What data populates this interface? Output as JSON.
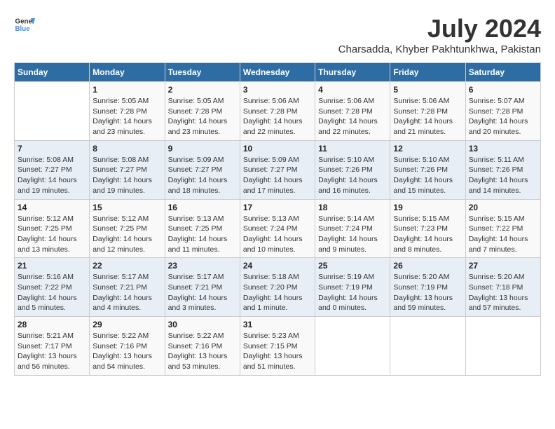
{
  "header": {
    "logo_line1": "General",
    "logo_line2": "Blue",
    "month_year": "July 2024",
    "location": "Charsadda, Khyber Pakhtunkhwa, Pakistan"
  },
  "weekdays": [
    "Sunday",
    "Monday",
    "Tuesday",
    "Wednesday",
    "Thursday",
    "Friday",
    "Saturday"
  ],
  "weeks": [
    [
      {
        "day": "",
        "info": ""
      },
      {
        "day": "1",
        "info": "Sunrise: 5:05 AM\nSunset: 7:28 PM\nDaylight: 14 hours\nand 23 minutes."
      },
      {
        "day": "2",
        "info": "Sunrise: 5:05 AM\nSunset: 7:28 PM\nDaylight: 14 hours\nand 23 minutes."
      },
      {
        "day": "3",
        "info": "Sunrise: 5:06 AM\nSunset: 7:28 PM\nDaylight: 14 hours\nand 22 minutes."
      },
      {
        "day": "4",
        "info": "Sunrise: 5:06 AM\nSunset: 7:28 PM\nDaylight: 14 hours\nand 22 minutes."
      },
      {
        "day": "5",
        "info": "Sunrise: 5:06 AM\nSunset: 7:28 PM\nDaylight: 14 hours\nand 21 minutes."
      },
      {
        "day": "6",
        "info": "Sunrise: 5:07 AM\nSunset: 7:28 PM\nDaylight: 14 hours\nand 20 minutes."
      }
    ],
    [
      {
        "day": "7",
        "info": "Sunrise: 5:08 AM\nSunset: 7:27 PM\nDaylight: 14 hours\nand 19 minutes."
      },
      {
        "day": "8",
        "info": "Sunrise: 5:08 AM\nSunset: 7:27 PM\nDaylight: 14 hours\nand 19 minutes."
      },
      {
        "day": "9",
        "info": "Sunrise: 5:09 AM\nSunset: 7:27 PM\nDaylight: 14 hours\nand 18 minutes."
      },
      {
        "day": "10",
        "info": "Sunrise: 5:09 AM\nSunset: 7:27 PM\nDaylight: 14 hours\nand 17 minutes."
      },
      {
        "day": "11",
        "info": "Sunrise: 5:10 AM\nSunset: 7:26 PM\nDaylight: 14 hours\nand 16 minutes."
      },
      {
        "day": "12",
        "info": "Sunrise: 5:10 AM\nSunset: 7:26 PM\nDaylight: 14 hours\nand 15 minutes."
      },
      {
        "day": "13",
        "info": "Sunrise: 5:11 AM\nSunset: 7:26 PM\nDaylight: 14 hours\nand 14 minutes."
      }
    ],
    [
      {
        "day": "14",
        "info": "Sunrise: 5:12 AM\nSunset: 7:25 PM\nDaylight: 14 hours\nand 13 minutes."
      },
      {
        "day": "15",
        "info": "Sunrise: 5:12 AM\nSunset: 7:25 PM\nDaylight: 14 hours\nand 12 minutes."
      },
      {
        "day": "16",
        "info": "Sunrise: 5:13 AM\nSunset: 7:25 PM\nDaylight: 14 hours\nand 11 minutes."
      },
      {
        "day": "17",
        "info": "Sunrise: 5:13 AM\nSunset: 7:24 PM\nDaylight: 14 hours\nand 10 minutes."
      },
      {
        "day": "18",
        "info": "Sunrise: 5:14 AM\nSunset: 7:24 PM\nDaylight: 14 hours\nand 9 minutes."
      },
      {
        "day": "19",
        "info": "Sunrise: 5:15 AM\nSunset: 7:23 PM\nDaylight: 14 hours\nand 8 minutes."
      },
      {
        "day": "20",
        "info": "Sunrise: 5:15 AM\nSunset: 7:22 PM\nDaylight: 14 hours\nand 7 minutes."
      }
    ],
    [
      {
        "day": "21",
        "info": "Sunrise: 5:16 AM\nSunset: 7:22 PM\nDaylight: 14 hours\nand 5 minutes."
      },
      {
        "day": "22",
        "info": "Sunrise: 5:17 AM\nSunset: 7:21 PM\nDaylight: 14 hours\nand 4 minutes."
      },
      {
        "day": "23",
        "info": "Sunrise: 5:17 AM\nSunset: 7:21 PM\nDaylight: 14 hours\nand 3 minutes."
      },
      {
        "day": "24",
        "info": "Sunrise: 5:18 AM\nSunset: 7:20 PM\nDaylight: 14 hours\nand 1 minute."
      },
      {
        "day": "25",
        "info": "Sunrise: 5:19 AM\nSunset: 7:19 PM\nDaylight: 14 hours\nand 0 minutes."
      },
      {
        "day": "26",
        "info": "Sunrise: 5:20 AM\nSunset: 7:19 PM\nDaylight: 13 hours\nand 59 minutes."
      },
      {
        "day": "27",
        "info": "Sunrise: 5:20 AM\nSunset: 7:18 PM\nDaylight: 13 hours\nand 57 minutes."
      }
    ],
    [
      {
        "day": "28",
        "info": "Sunrise: 5:21 AM\nSunset: 7:17 PM\nDaylight: 13 hours\nand 56 minutes."
      },
      {
        "day": "29",
        "info": "Sunrise: 5:22 AM\nSunset: 7:16 PM\nDaylight: 13 hours\nand 54 minutes."
      },
      {
        "day": "30",
        "info": "Sunrise: 5:22 AM\nSunset: 7:16 PM\nDaylight: 13 hours\nand 53 minutes."
      },
      {
        "day": "31",
        "info": "Sunrise: 5:23 AM\nSunset: 7:15 PM\nDaylight: 13 hours\nand 51 minutes."
      },
      {
        "day": "",
        "info": ""
      },
      {
        "day": "",
        "info": ""
      },
      {
        "day": "",
        "info": ""
      }
    ]
  ]
}
